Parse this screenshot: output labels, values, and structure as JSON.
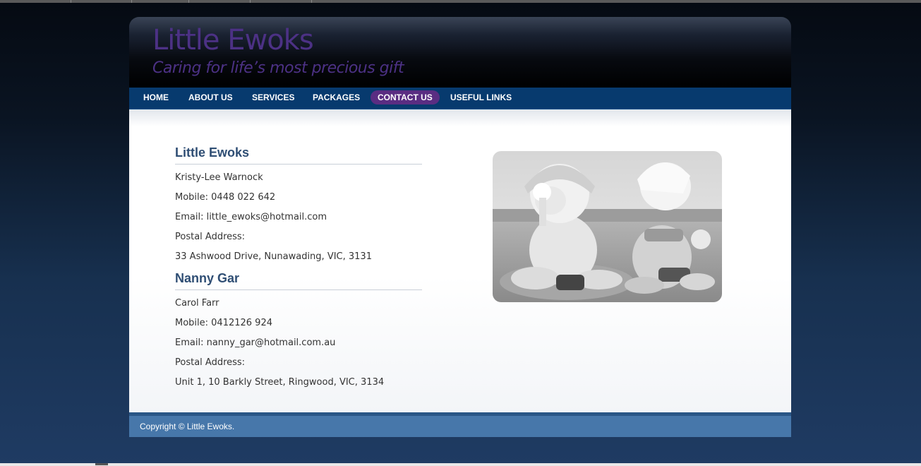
{
  "site": {
    "title": "Little Ewoks",
    "tagline": "Caring for life’s most precious gift"
  },
  "nav": {
    "items": [
      {
        "label": "HOME",
        "active": false
      },
      {
        "label": "ABOUT US",
        "active": false
      },
      {
        "label": "SERVICES",
        "active": false
      },
      {
        "label": "PACKAGES",
        "active": false
      },
      {
        "label": "CONTACT US",
        "active": true
      },
      {
        "label": "USEFUL LINKS",
        "active": false
      }
    ],
    "active_color": "#5a2d82",
    "bar_color": "#073a6e"
  },
  "contacts": [
    {
      "heading": "Little Ewoks",
      "name": "Kristy-Lee Warnock",
      "mobile": "Mobile: 0448 022 642",
      "email": "Email: little_ewoks@hotmail.com",
      "postal_label": "Postal Address:",
      "address": "33 Ashwood Drive, Nunawading, VIC, 3131"
    },
    {
      "heading": "Nanny Gar",
      "name": "Carol Farr",
      "mobile": "Mobile: 0412126 924",
      "email": "Email: nanny_gar@hotmail.com.au",
      "postal_label": "Postal Address:",
      "address": "Unit 1, 10 Barkly Street, Ringwood, VIC, 3134"
    }
  ],
  "photo": {
    "icon": "beach-toddlers-photo"
  },
  "footer": {
    "copyright": "Copyright © Little Ewoks."
  }
}
